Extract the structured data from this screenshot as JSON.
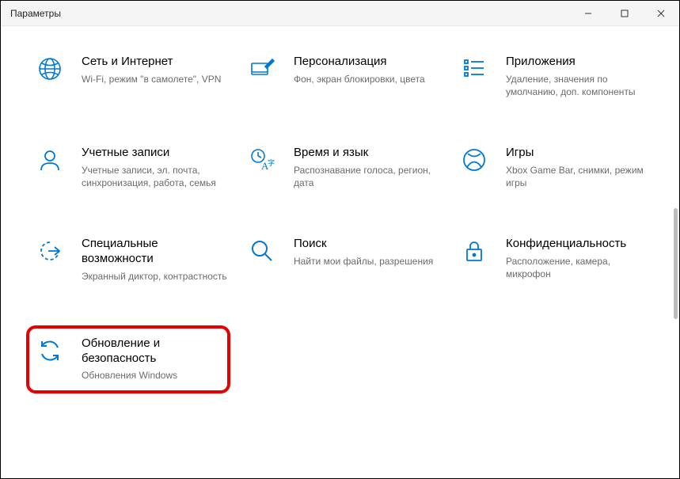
{
  "window": {
    "title": "Параметры"
  },
  "tiles": [
    {
      "title": "Сеть и Интернет",
      "desc": "Wi-Fi, режим \"в самолете\", VPN"
    },
    {
      "title": "Персонализация",
      "desc": "Фон, экран блокировки, цвета"
    },
    {
      "title": "Приложения",
      "desc": "Удаление, значения по умолчанию, доп. компоненты"
    },
    {
      "title": "Учетные записи",
      "desc": "Учетные записи, эл. почта, синхронизация, работа, семья"
    },
    {
      "title": "Время и язык",
      "desc": "Распознавание голоса, регион, дата"
    },
    {
      "title": "Игры",
      "desc": "Xbox Game Bar, снимки, режим игры"
    },
    {
      "title": "Специальные возможности",
      "desc": "Экранный диктор, контрастность"
    },
    {
      "title": "Поиск",
      "desc": "Найти мои файлы, разрешения"
    },
    {
      "title": "Конфиденциальность",
      "desc": "Расположение, камера, микрофон"
    },
    {
      "title": "Обновление и безопасность",
      "desc": "Обновления Windows"
    }
  ]
}
